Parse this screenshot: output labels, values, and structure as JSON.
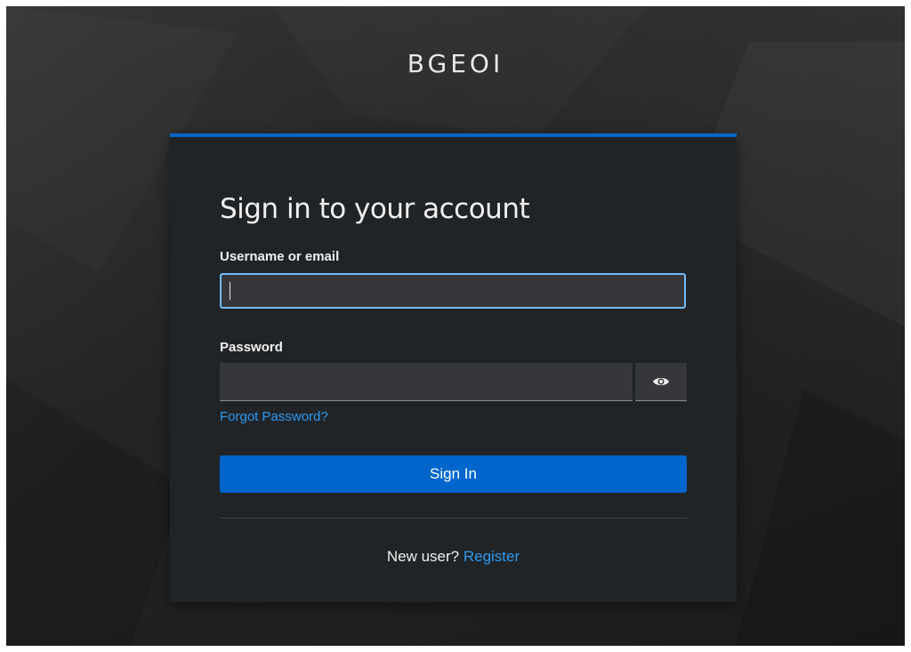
{
  "brand": {
    "name": "BGEOI"
  },
  "login": {
    "title": "Sign in to your account",
    "username_label": "Username or email",
    "username_value": "",
    "password_label": "Password",
    "password_value": "",
    "show_password_icon": "eye-icon",
    "forgot_password": "Forgot Password?",
    "sign_in_button": "Sign In",
    "new_user_text": "New user?",
    "register_link": "Register"
  },
  "colors": {
    "accent": "#0066cc",
    "link": "#2b9af3",
    "card_bg": "#212427",
    "input_bg": "#36373a",
    "focus_border": "#73bcf7"
  }
}
